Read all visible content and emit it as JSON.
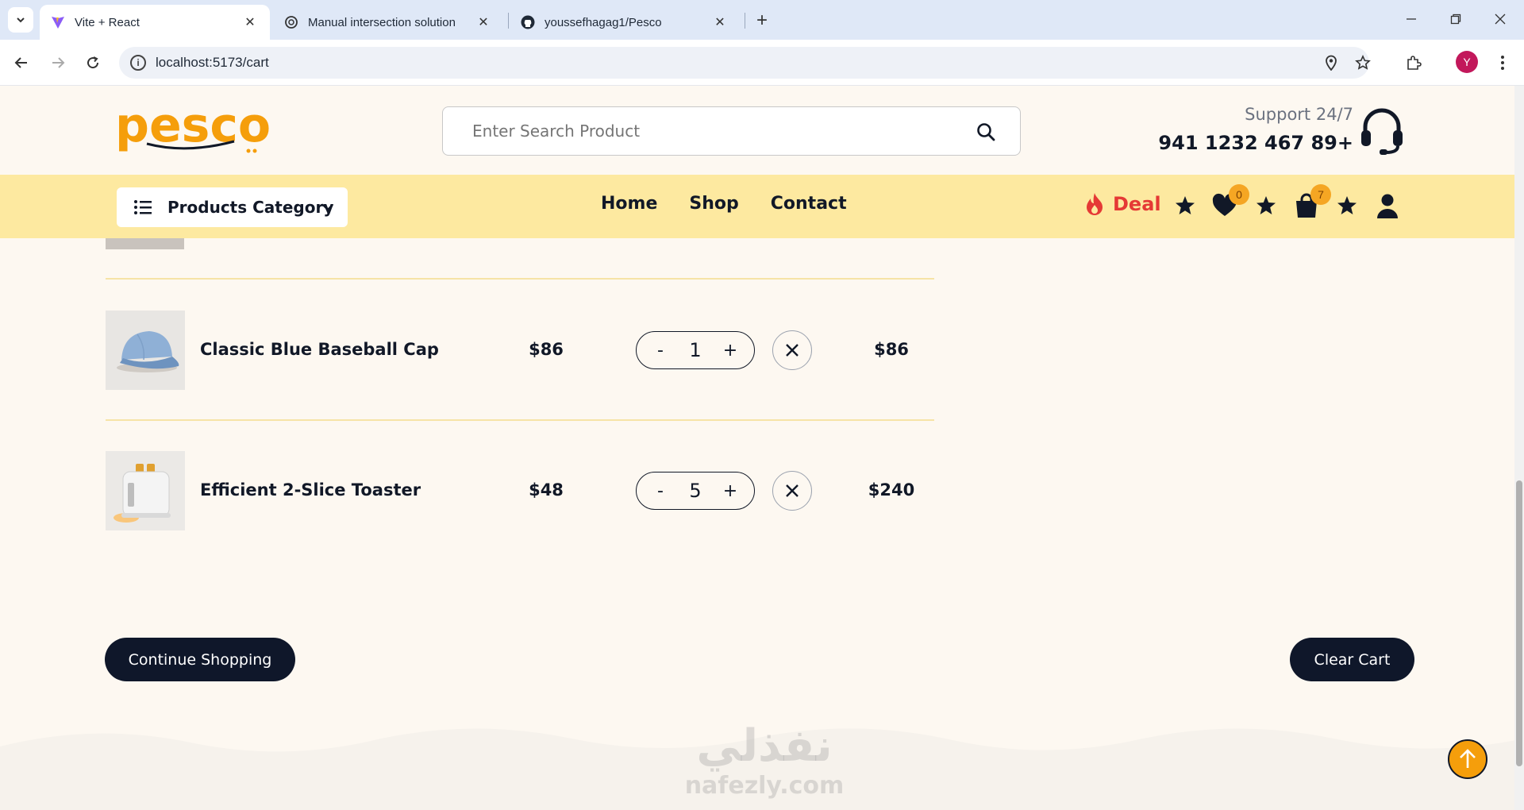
{
  "browser": {
    "tabs": [
      {
        "title": "Vite + React",
        "active": true,
        "favicon": "vite-icon"
      },
      {
        "title": "Manual intersection solution",
        "active": false,
        "favicon": "openai-icon"
      },
      {
        "title": "youssefhagag1/Pesco",
        "active": false,
        "favicon": "github-icon"
      }
    ],
    "url": "localhost:5173/cart",
    "profile_initial": "Y"
  },
  "header": {
    "logo_text": "pesco",
    "search_placeholder": "Enter Search Product",
    "support_label": "Support 24/7",
    "support_phone": "941 1232 467 89+"
  },
  "nav": {
    "category_label": "Products Category",
    "links": [
      "Home",
      "Shop",
      "Contact"
    ],
    "deal_label": "Deal",
    "wishlist_count": "0",
    "cart_count": "7"
  },
  "cart": {
    "items": [
      {
        "name": "Classic Blue Baseball Cap",
        "price": "$86",
        "quantity": "1",
        "total": "$86",
        "minus": "-",
        "plus": "+"
      },
      {
        "name": "Efficient 2-Slice Toaster",
        "price": "$48",
        "quantity": "5",
        "total": "$240",
        "minus": "-",
        "plus": "+"
      }
    ],
    "continue_label": "Continue Shopping",
    "clear_label": "Clear Cart"
  },
  "watermark": {
    "arabic": "نفذلي",
    "latin": "nafezly.com"
  },
  "colors": {
    "accent": "#f59e0b",
    "nav_bg": "#fde9a0",
    "dark": "#0f172a",
    "deal": "#e53935"
  }
}
